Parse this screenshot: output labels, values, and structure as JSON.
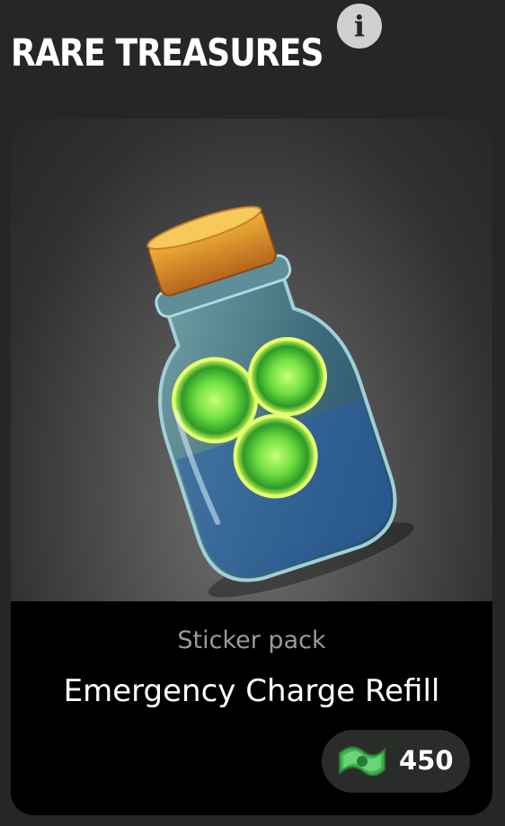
{
  "header": {
    "title": "RARE TREASURES",
    "info_icon": "info-icon"
  },
  "item": {
    "image_icon": "potion-bottle-with-glowing-green-orbs",
    "category": "Sticker pack",
    "name": "Emergency Charge Refill",
    "price": "450",
    "currency_icon": "green-cash-icon"
  },
  "colors": {
    "background": "#242724",
    "panel": "#000000",
    "price_pill": "#2a2c2a",
    "orb_green": "#7de84a",
    "currency_green": "#5fd36a"
  }
}
